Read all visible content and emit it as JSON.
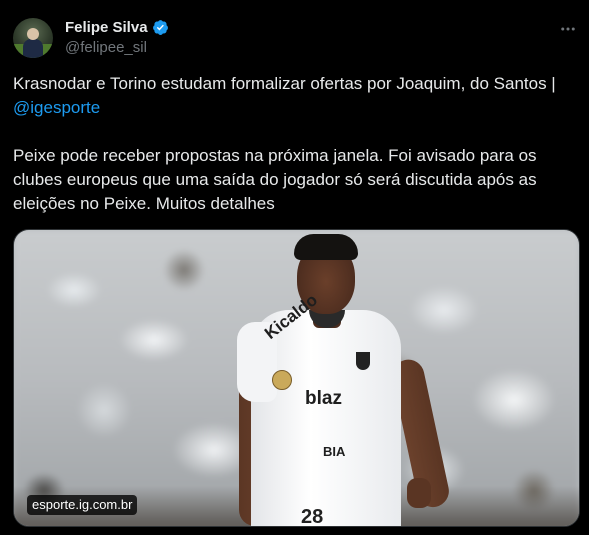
{
  "author": {
    "display_name": "Felipe Silva",
    "handle": "@felipee_sil",
    "verified_icon": "verified-badge-icon",
    "verified_color": "#1d9bf0"
  },
  "menu": {
    "icon": "more-options-icon"
  },
  "tweet": {
    "line1_text": "Krasnodar e Torino estudam formalizar ofertas por Joaquim, do Santos | ",
    "mention": "@igesporte",
    "paragraph2": "Peixe pode receber propostas na próxima janela. Foi avisado para os clubes europeus que uma saída do jogador só será discutida após as eleições no Peixe. Muitos detalhes"
  },
  "media": {
    "source_label": "esporte.ig.com.br",
    "jersey": {
      "front_text": "Kicaldo",
      "sponsor": "blaz",
      "sub_sponsor": "BIA",
      "number": "28"
    }
  },
  "colors": {
    "background": "#000000",
    "text": "#e7e9ea",
    "secondary_text": "#71767b",
    "link": "#1d9bf0",
    "border": "#2f3336"
  }
}
